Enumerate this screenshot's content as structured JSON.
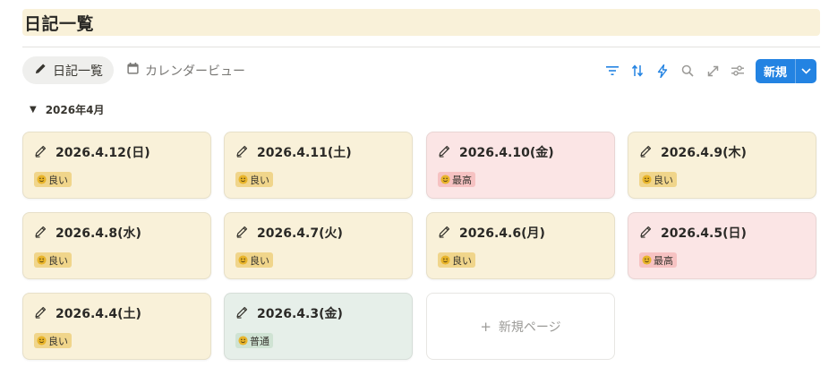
{
  "page": {
    "title": "日記一覧"
  },
  "views": [
    {
      "label": "日記一覧",
      "icon": "pencil-icon",
      "active": true
    },
    {
      "label": "カレンダービュー",
      "icon": "calendar-icon",
      "active": false
    }
  ],
  "toolbar": {
    "icons": [
      "filter-icon",
      "sort-icon",
      "automation-icon",
      "search-icon",
      "expand-icon",
      "settings-icon"
    ],
    "new_label": "新規"
  },
  "group": {
    "label": "2026年4月"
  },
  "cards": [
    {
      "date": "2026.4.12(日)",
      "tag": "良い",
      "mood": "good"
    },
    {
      "date": "2026.4.11(土)",
      "tag": "良い",
      "mood": "good"
    },
    {
      "date": "2026.4.10(金)",
      "tag": "最高",
      "mood": "best"
    },
    {
      "date": "2026.4.9(木)",
      "tag": "良い",
      "mood": "good"
    },
    {
      "date": "2026.4.8(水)",
      "tag": "良い",
      "mood": "good"
    },
    {
      "date": "2026.4.7(火)",
      "tag": "良い",
      "mood": "good"
    },
    {
      "date": "2026.4.6(月)",
      "tag": "良い",
      "mood": "good"
    },
    {
      "date": "2026.4.5(日)",
      "tag": "最高",
      "mood": "best"
    },
    {
      "date": "2026.4.4(土)",
      "tag": "良い",
      "mood": "good"
    },
    {
      "date": "2026.4.3(金)",
      "tag": "普通",
      "mood": "normal"
    }
  ],
  "new_page_label": "新規ページ",
  "colors": {
    "accent": "#2383e2",
    "card_good": "#f9f1d9",
    "card_best": "#fbe5e5",
    "card_normal": "#e6efe9"
  }
}
